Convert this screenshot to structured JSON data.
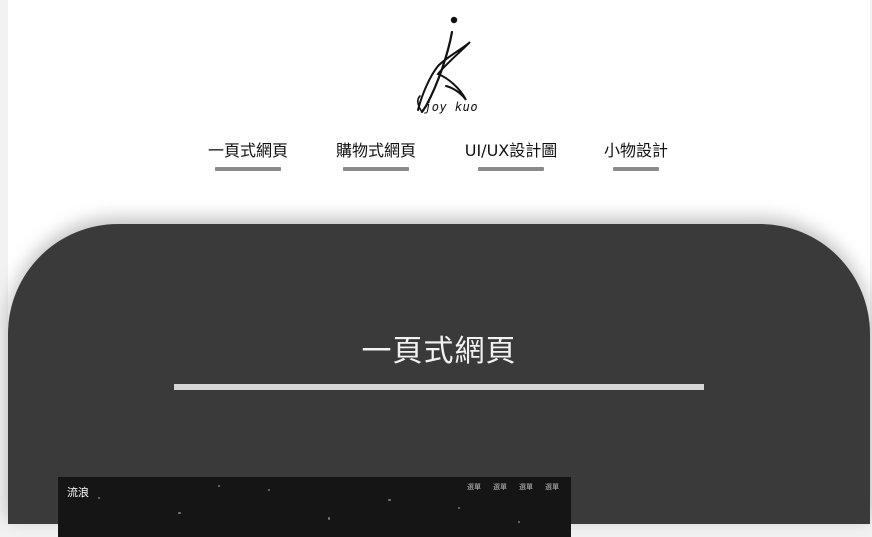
{
  "brand": {
    "logo_text": "joy kuo"
  },
  "nav": {
    "items": [
      {
        "label": "一頁式網頁"
      },
      {
        "label": "購物式網頁"
      },
      {
        "label": "UI/UX設計圖"
      },
      {
        "label": "小物設計"
      }
    ]
  },
  "section": {
    "title": "一頁式網頁"
  },
  "preview": {
    "label": "流浪",
    "nav_items": [
      "選單",
      "選單",
      "選單",
      "選單"
    ]
  },
  "colors": {
    "dark_panel": "#3a3a3a",
    "nav_bar": "#8a8a8a",
    "rule": "#d6d6d6"
  }
}
